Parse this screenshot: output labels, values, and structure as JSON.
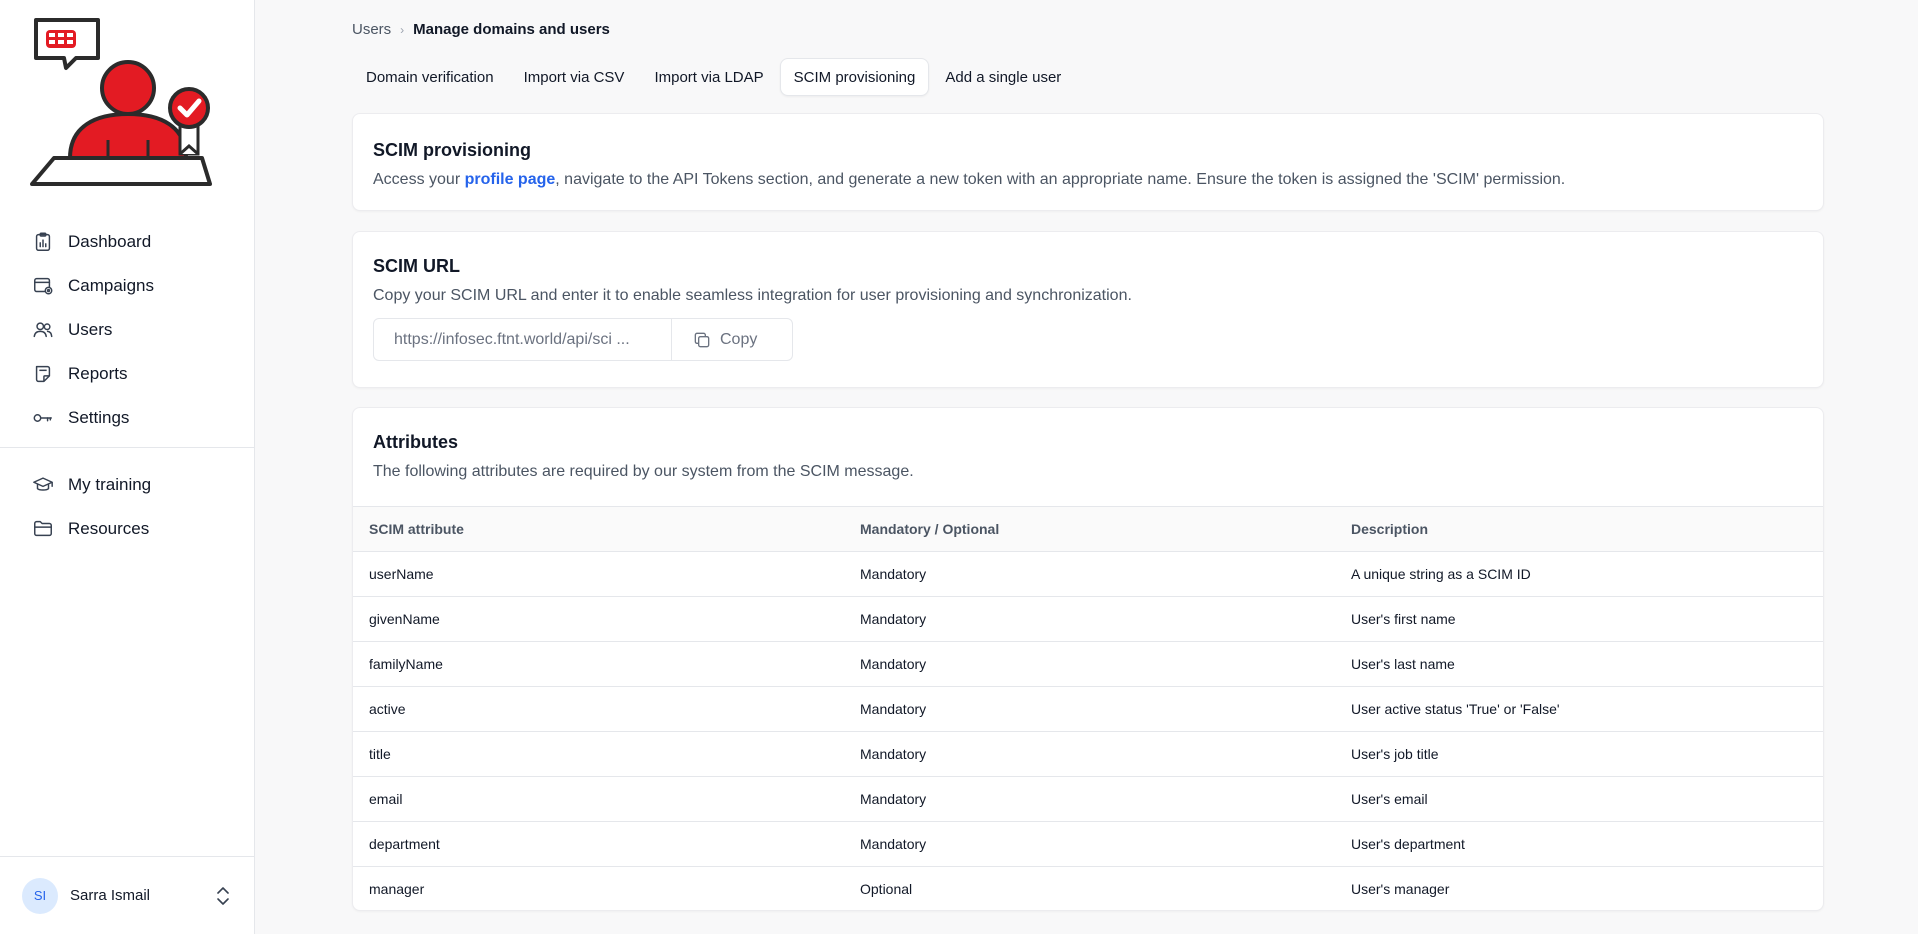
{
  "sidebar": {
    "nav": [
      {
        "label": "Dashboard",
        "icon": "clipboard-chart-icon"
      },
      {
        "label": "Campaigns",
        "icon": "browser-window-icon"
      },
      {
        "label": "Users",
        "icon": "users-icon"
      },
      {
        "label": "Reports",
        "icon": "document-icon"
      },
      {
        "label": "Settings",
        "icon": "key-icon"
      }
    ],
    "nav2": [
      {
        "label": "My training",
        "icon": "graduation-cap-icon"
      },
      {
        "label": "Resources",
        "icon": "folder-icon"
      }
    ],
    "user": {
      "initials": "SI",
      "name": "Sarra Ismail"
    }
  },
  "breadcrumb": {
    "parent": "Users",
    "current": "Manage domains and users"
  },
  "tabs": [
    {
      "label": "Domain verification",
      "active": false
    },
    {
      "label": "Import via CSV",
      "active": false
    },
    {
      "label": "Import via LDAP",
      "active": false
    },
    {
      "label": "SCIM provisioning",
      "active": true
    },
    {
      "label": "Add a single user",
      "active": false
    }
  ],
  "scim": {
    "title": "SCIM provisioning",
    "desc_before": "Access your ",
    "desc_link": "profile page",
    "desc_after": ", navigate to the API Tokens section, and generate a new token with an appropriate name. Ensure the token is assigned the 'SCIM' permission."
  },
  "scim_url": {
    "title": "SCIM URL",
    "desc": "Copy your SCIM URL and enter it to enable seamless integration for user provisioning and synchronization.",
    "value": "https://infosec.ftnt.world/api/sci   ...",
    "copy_label": "Copy"
  },
  "attributes": {
    "title": "Attributes",
    "desc": "The following attributes are required by our system from the SCIM message.",
    "columns": [
      "SCIM attribute",
      "Mandatory / Optional",
      "Description"
    ],
    "rows": [
      [
        "userName",
        "Mandatory",
        "A unique string as a SCIM ID"
      ],
      [
        "givenName",
        "Mandatory",
        "User's first name"
      ],
      [
        "familyName",
        "Mandatory",
        "User's last name"
      ],
      [
        "active",
        "Mandatory",
        "User active status 'True' or 'False'"
      ],
      [
        "title",
        "Mandatory",
        "User's job title"
      ],
      [
        "email",
        "Mandatory",
        "User's email"
      ],
      [
        "department",
        "Mandatory",
        "User's department"
      ],
      [
        "manager",
        "Optional",
        "User's manager"
      ]
    ]
  },
  "colors": {
    "brand_red": "#e31b23",
    "link_blue": "#2563eb"
  }
}
